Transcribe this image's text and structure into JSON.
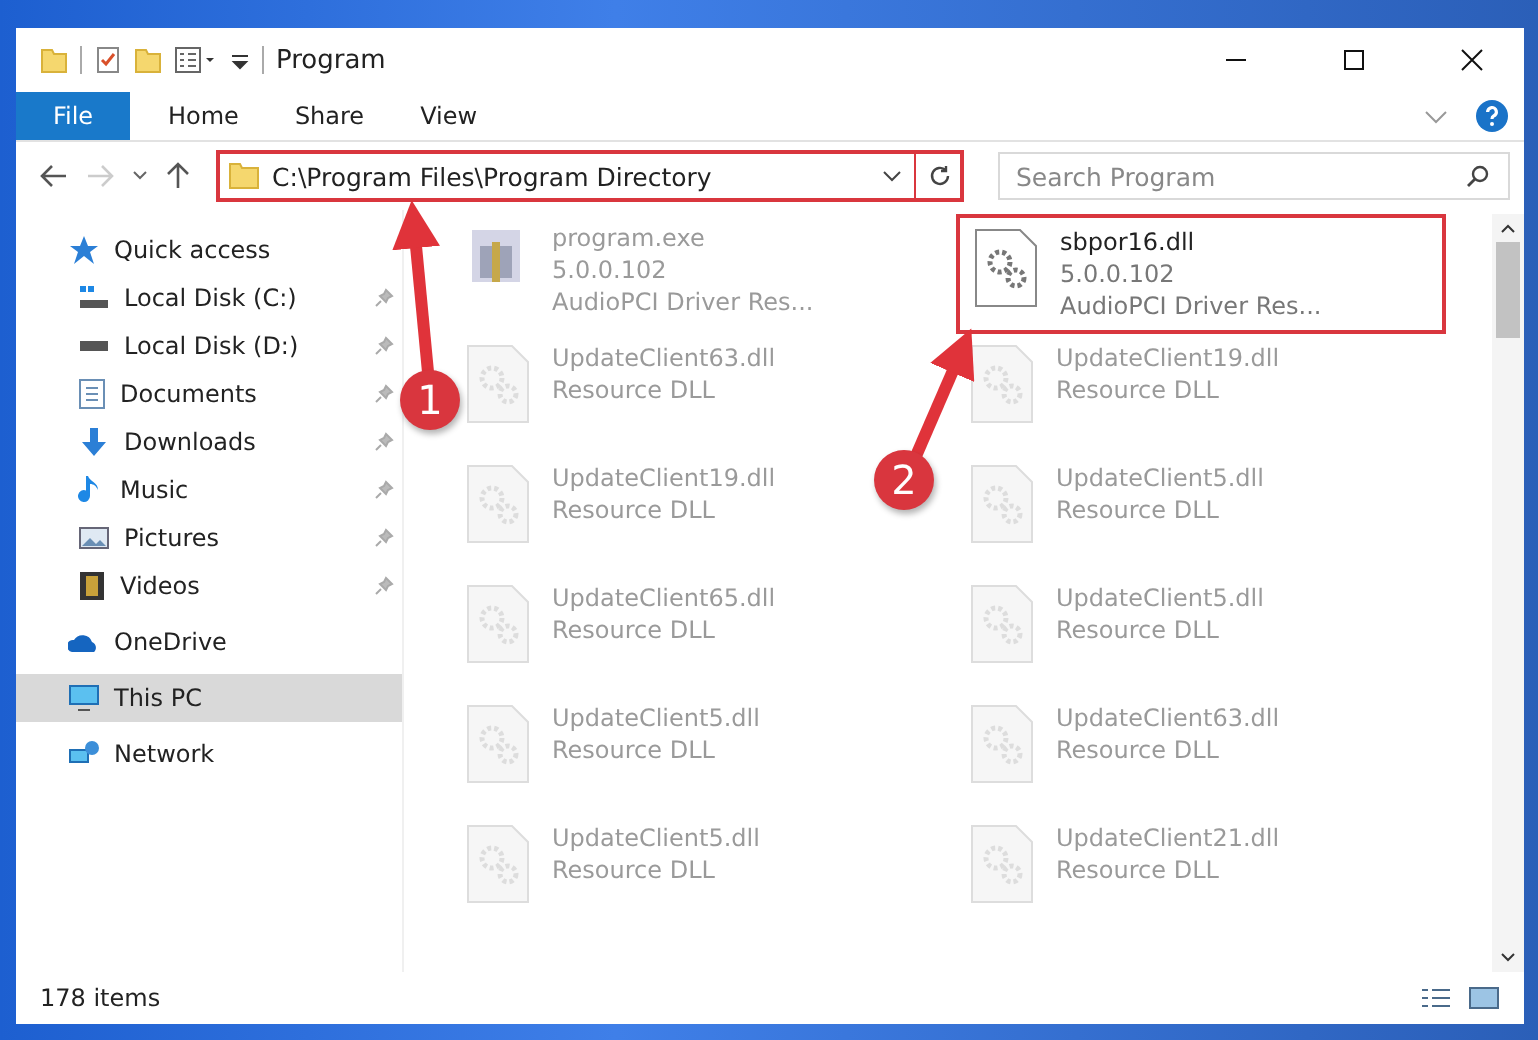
{
  "window": {
    "title": "Program"
  },
  "ribbon_tabs": [
    {
      "label": "File",
      "kind": "file"
    },
    {
      "label": "Home",
      "kind": "tab"
    },
    {
      "label": "Share",
      "kind": "tab"
    },
    {
      "label": "View",
      "kind": "tab"
    }
  ],
  "address_bar": {
    "path": "C:\\Program Files\\Program Directory",
    "highlighted": true
  },
  "search": {
    "placeholder": "Search Program"
  },
  "sidebar": {
    "items": [
      {
        "label": "Quick access",
        "kind": "star",
        "selected": false,
        "children": [
          {
            "label": "Local Disk (C:)",
            "kind": "disk-win",
            "pinned": true
          },
          {
            "label": "Local Disk (D:)",
            "kind": "disk",
            "pinned": true
          },
          {
            "label": "Documents",
            "kind": "doc",
            "pinned": true
          },
          {
            "label": "Downloads",
            "kind": "download",
            "pinned": true
          },
          {
            "label": "Music",
            "kind": "music",
            "pinned": true
          },
          {
            "label": "Pictures",
            "kind": "pictures",
            "pinned": true
          },
          {
            "label": "Videos",
            "kind": "videos",
            "pinned": true
          }
        ]
      },
      {
        "label": "OneDrive",
        "kind": "cloud",
        "selected": false
      },
      {
        "label": "This PC",
        "kind": "pc",
        "selected": true
      },
      {
        "label": "Network",
        "kind": "network",
        "selected": false
      }
    ]
  },
  "files": [
    {
      "name": "program.exe",
      "lines": [
        "5.0.0.102",
        "AudioPCI Driver Res..."
      ],
      "kind": "exe",
      "highlighted": false
    },
    {
      "name": "sbpor16.dll",
      "lines": [
        "5.0.0.102",
        "AudioPCI Driver Res..."
      ],
      "kind": "dll",
      "highlighted": true
    },
    {
      "name": "UpdateClient63.dll",
      "lines": [
        "Resource DLL"
      ],
      "kind": "dll",
      "highlighted": false
    },
    {
      "name": "UpdateClient19.dll",
      "lines": [
        "Resource DLL"
      ],
      "kind": "dll",
      "highlighted": false
    },
    {
      "name": "UpdateClient19.dll",
      "lines": [
        "Resource DLL"
      ],
      "kind": "dll",
      "highlighted": false
    },
    {
      "name": "UpdateClient5.dll",
      "lines": [
        "Resource DLL"
      ],
      "kind": "dll",
      "highlighted": false
    },
    {
      "name": "UpdateClient65.dll",
      "lines": [
        "Resource DLL"
      ],
      "kind": "dll",
      "highlighted": false
    },
    {
      "name": "UpdateClient5.dll",
      "lines": [
        "Resource DLL"
      ],
      "kind": "dll",
      "highlighted": false
    },
    {
      "name": "UpdateClient5.dll",
      "lines": [
        "Resource DLL"
      ],
      "kind": "dll",
      "highlighted": false
    },
    {
      "name": "UpdateClient63.dll",
      "lines": [
        "Resource DLL"
      ],
      "kind": "dll",
      "highlighted": false
    },
    {
      "name": "UpdateClient5.dll",
      "lines": [
        "Resource DLL"
      ],
      "kind": "dll",
      "highlighted": false
    },
    {
      "name": "UpdateClient21.dll",
      "lines": [
        "Resource DLL"
      ],
      "kind": "dll",
      "highlighted": false
    }
  ],
  "status_bar": {
    "item_count": "178 items"
  },
  "callouts": [
    {
      "number": "1"
    },
    {
      "number": "2"
    }
  ]
}
